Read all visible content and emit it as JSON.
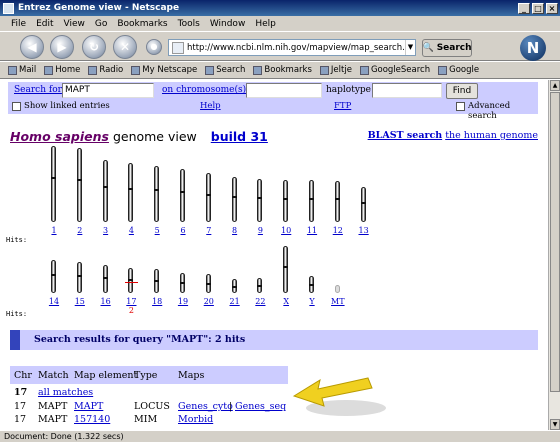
{
  "window": {
    "title": "Entrez Genome view - Netscape",
    "controls": [
      "_",
      "□",
      "×"
    ]
  },
  "menu": [
    "File",
    "Edit",
    "View",
    "Go",
    "Bookmarks",
    "Tools",
    "Window",
    "Help"
  ],
  "toolbar": {
    "url": "http://www.ncbi.nlm.nih.gov/mapview/map_search.cgi?chr=hum_",
    "search_label": "Search",
    "logo": "N"
  },
  "bookmarks": [
    "Mail",
    "Home",
    "Radio",
    "My Netscape",
    "Search",
    "Bookmarks",
    "Jeltje",
    "GoogleSearch",
    "Google"
  ],
  "form": {
    "search_for_label": "Search for",
    "search_value": "MAPT",
    "on_chromosome_label": "on chromosome(s)",
    "chromosome_value": "",
    "haplotype_label": "haplotype",
    "haplotype_value": "",
    "find_label": "Find",
    "show_linked_label": "Show linked entries",
    "help_label": "Help",
    "ftp_label": "FTP",
    "advanced_label": "Advanced search"
  },
  "page": {
    "species": "Homo sapiens",
    "genome_view": "genome view",
    "build": "build 31",
    "blast_link": "BLAST search",
    "blast_target": "the human genome",
    "hits_label": "Hits:"
  },
  "chromosomes_row1": [
    {
      "label": "1",
      "size": 1.0
    },
    {
      "label": "2",
      "size": 0.97
    },
    {
      "label": "3",
      "size": 0.81
    },
    {
      "label": "4",
      "size": 0.78
    },
    {
      "label": "5",
      "size": 0.74
    },
    {
      "label": "6",
      "size": 0.7
    },
    {
      "label": "7",
      "size": 0.64
    },
    {
      "label": "8",
      "size": 0.59
    },
    {
      "label": "9",
      "size": 0.56
    },
    {
      "label": "10",
      "size": 0.55
    },
    {
      "label": "11",
      "size": 0.55
    },
    {
      "label": "12",
      "size": 0.54
    },
    {
      "label": "13",
      "size": 0.46
    }
  ],
  "chromosomes_row2": [
    {
      "label": "14",
      "size": 0.43
    },
    {
      "label": "15",
      "size": 0.41
    },
    {
      "label": "16",
      "size": 0.37
    },
    {
      "label": "17",
      "size": 0.33,
      "hits": "2"
    },
    {
      "label": "18",
      "size": 0.31
    },
    {
      "label": "19",
      "size": 0.26
    },
    {
      "label": "20",
      "size": 0.25
    },
    {
      "label": "21",
      "size": 0.19
    },
    {
      "label": "22",
      "size": 0.2
    },
    {
      "label": "X",
      "size": 0.62
    },
    {
      "label": "Y",
      "size": 0.23
    },
    {
      "label": "MT",
      "size": 0.05
    }
  ],
  "results": {
    "title": "Search results for query \"MAPT\":   2 hits",
    "columns": [
      "Chr",
      "Match",
      "Map element",
      "Type",
      "Maps"
    ],
    "all_row": {
      "chr": "17",
      "label": "all matches"
    },
    "rows": [
      {
        "chr": "17",
        "match": "MAPT",
        "element": "MAPT",
        "type": "LOCUS",
        "maps": [
          "Genes_cyto",
          "Genes_seq"
        ]
      },
      {
        "chr": "17",
        "match": "MAPT",
        "element": "157140",
        "type": "MIM",
        "maps": [
          "Morbid"
        ]
      }
    ]
  },
  "status": "Document: Done (1.322 secs)",
  "colors": {
    "panel": "#ccccff",
    "link": "#0000cc",
    "hit": "#e00000",
    "arrow": "#f0d020"
  }
}
